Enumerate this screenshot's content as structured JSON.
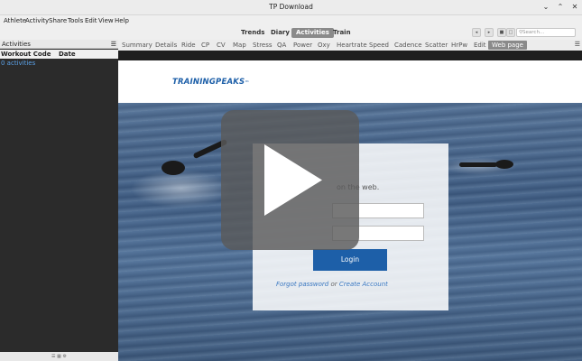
{
  "window": {
    "title": "TP Download",
    "minimize": "⌄",
    "maximize": "⌃",
    "close": "✕"
  },
  "menus": [
    "Athlete",
    "Activity",
    "Share",
    "Tools",
    "Edit",
    "View",
    "Help"
  ],
  "view_tabs": [
    {
      "label": "Trends",
      "active": false
    },
    {
      "label": "Diary",
      "active": false
    },
    {
      "label": "Activities",
      "active": true
    },
    {
      "label": "Train",
      "active": false
    }
  ],
  "search": {
    "placeholder": "Search..."
  },
  "sidebar": {
    "title": "Activities",
    "columns": [
      "Workout Code",
      "Date"
    ],
    "count": "0 activities"
  },
  "chart_tabs": [
    {
      "label": "Summary",
      "active": false
    },
    {
      "label": "Details",
      "active": false
    },
    {
      "label": "Ride",
      "active": false
    },
    {
      "label": "CP",
      "active": false
    },
    {
      "label": "CV",
      "active": false
    },
    {
      "label": "Map",
      "active": false
    },
    {
      "label": "Stress",
      "active": false
    },
    {
      "label": "QA",
      "active": false
    },
    {
      "label": "Power",
      "active": false
    },
    {
      "label": "Oxy",
      "active": false
    },
    {
      "label": "Heartrate",
      "active": false
    },
    {
      "label": "Speed",
      "active": false
    },
    {
      "label": "Cadence",
      "active": false
    },
    {
      "label": "Scatter",
      "active": false
    },
    {
      "label": "HrPw",
      "active": false
    },
    {
      "label": "Edit",
      "active": false
    },
    {
      "label": "Web page",
      "active": true
    }
  ],
  "webpage": {
    "logo": "TRAININGPEAKS",
    "logo_tm": "™",
    "login_text": "on the web.",
    "login_button": "Login",
    "forgot_link": "Forgot password",
    "or_text": " or ",
    "create_link": "Create Account"
  },
  "colors": {
    "brand": "#1d5fa8",
    "link": "#3a78c2",
    "active_tab": "#8a8a8a"
  }
}
